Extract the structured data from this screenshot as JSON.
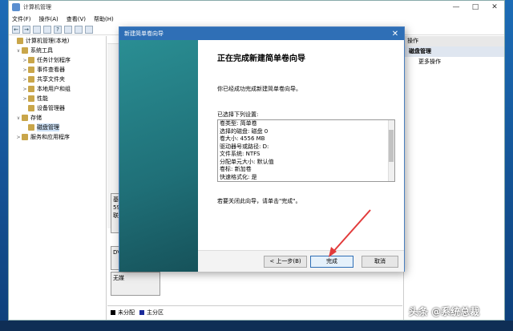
{
  "window": {
    "title": "计算机管理",
    "min": "—",
    "max": "□",
    "close": "✕"
  },
  "menu": [
    "文件(F)",
    "操作(A)",
    "查看(V)",
    "帮助(H)"
  ],
  "tree": [
    {
      "label": "计算机管理(本地)",
      "exp": "",
      "indent": 0
    },
    {
      "label": "系统工具",
      "exp": "∨",
      "indent": 1
    },
    {
      "label": "任务计划程序",
      "exp": ">",
      "indent": 2
    },
    {
      "label": "事件查看器",
      "exp": ">",
      "indent": 2
    },
    {
      "label": "共享文件夹",
      "exp": ">",
      "indent": 2
    },
    {
      "label": "本地用户和组",
      "exp": ">",
      "indent": 2
    },
    {
      "label": "性能",
      "exp": ">",
      "indent": 2
    },
    {
      "label": "设备管理器",
      "exp": "",
      "indent": 2
    },
    {
      "label": "存储",
      "exp": "∨",
      "indent": 1
    },
    {
      "label": "磁盘管理",
      "exp": "",
      "indent": 2,
      "selected": true
    },
    {
      "label": "服务和应用程序",
      "exp": ">",
      "indent": 1
    }
  ],
  "center": {
    "disk_rows": [
      {
        "text": "基\n59\n联"
      },
      {
        "text": "DV"
      },
      {
        "text": "无媒"
      }
    ],
    "legend": [
      {
        "label": "未分配",
        "color": "#000000"
      },
      {
        "label": "主分区",
        "color": "#1a2a9a"
      }
    ]
  },
  "actions": {
    "header": "操作",
    "section": "磁盘管理",
    "items": [
      "更多操作"
    ]
  },
  "wizard": {
    "title": "新建简单卷向导",
    "close": "✕",
    "heading": "正在完成新建简单卷向导",
    "intro": "你已经成功完成新建简单卷向导。",
    "selected_label": "已选择下列设置:",
    "settings": [
      "卷类型: 简单卷",
      "选择的磁盘: 磁盘 0",
      "卷大小: 4556 MB",
      "驱动器号或路径: D:",
      "文件系统: NTFS",
      "分配单元大小: 默认值",
      "卷标: 新加卷",
      "快速格式化: 是"
    ],
    "close_hint": "若要关闭此向导，请单击\"完成\"。",
    "back_button": "< 上一步(B)",
    "finish_button": "完成",
    "cancel_button": "取消"
  },
  "watermark": "头条 @系统总裁",
  "accent": "#2f6fb6",
  "arrow_color": "#e23b3b"
}
